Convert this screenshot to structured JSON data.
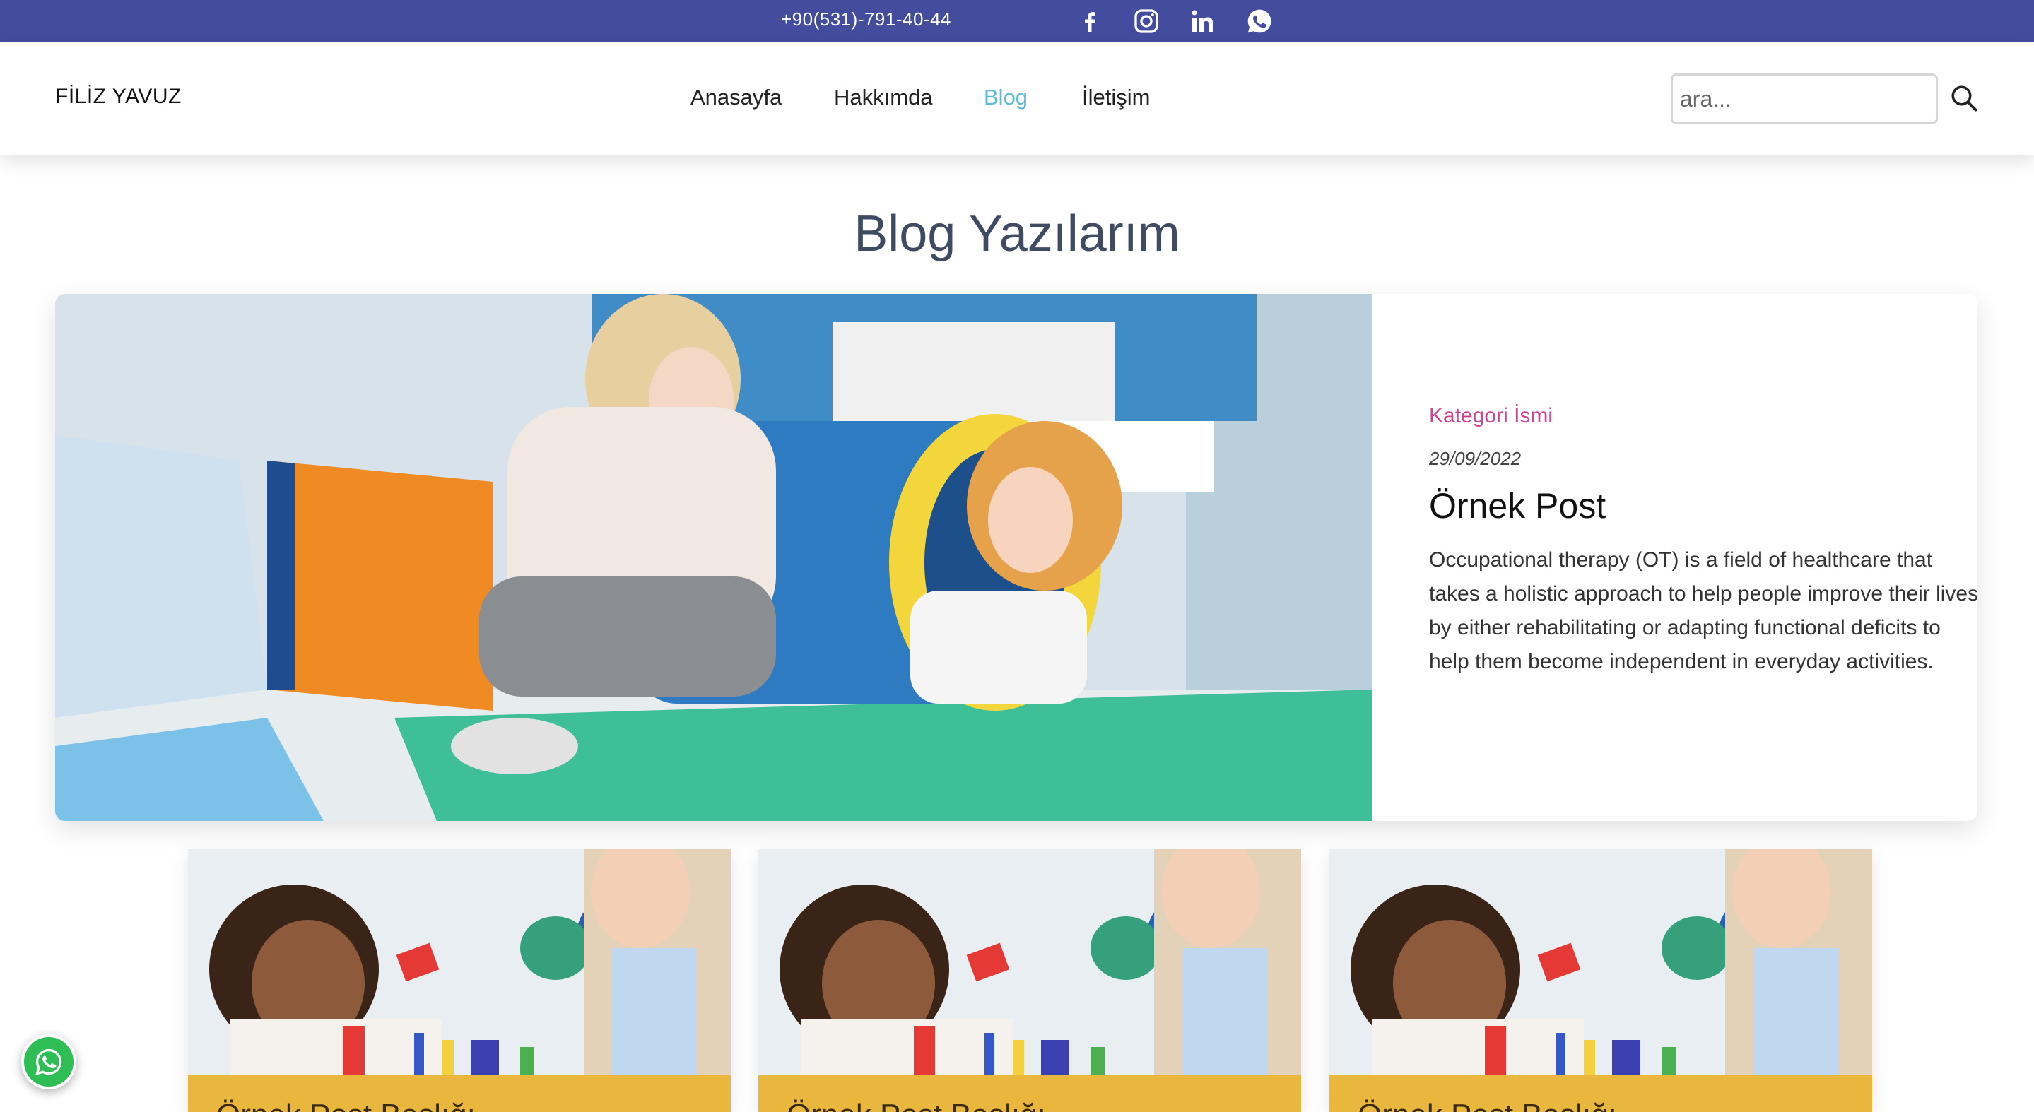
{
  "topbar": {
    "phone": "+90(531)-791-40-44",
    "social_icons": [
      "facebook-icon",
      "instagram-icon",
      "linkedin-icon",
      "whatsapp-icon"
    ],
    "bg_color": "#444c9e"
  },
  "header": {
    "brand": "FİLİZ YAVUZ",
    "nav": [
      {
        "label": "Anasayfa",
        "active": false
      },
      {
        "label": "Hakkımda",
        "active": false
      },
      {
        "label": "Blog",
        "active": true
      },
      {
        "label": "İletişim",
        "active": false
      }
    ],
    "search": {
      "placeholder": "ara..."
    },
    "active_color": "#5dbbd8"
  },
  "page": {
    "title": "Blog Yazılarım"
  },
  "featured_post": {
    "category": "Kategori İsmi",
    "date": "29/09/2022",
    "title": "Örnek Post",
    "excerpt": "Occupational therapy (OT) is a field of healthcare that takes a holistic approach to help people improve their lives by either rehabilitating or adapting functional deficits to help them become independent in everyday activities.",
    "category_color": "#d0438f"
  },
  "cards": [
    {
      "title": "Örnek Post Başlığı"
    },
    {
      "title": "Örnek Post Başlığı"
    },
    {
      "title": "Örnek Post Başlığı"
    }
  ],
  "card_band_color": "#e9b73d",
  "floating_whatsapp": {
    "icon": "whatsapp-icon",
    "color": "#2fbd55"
  }
}
